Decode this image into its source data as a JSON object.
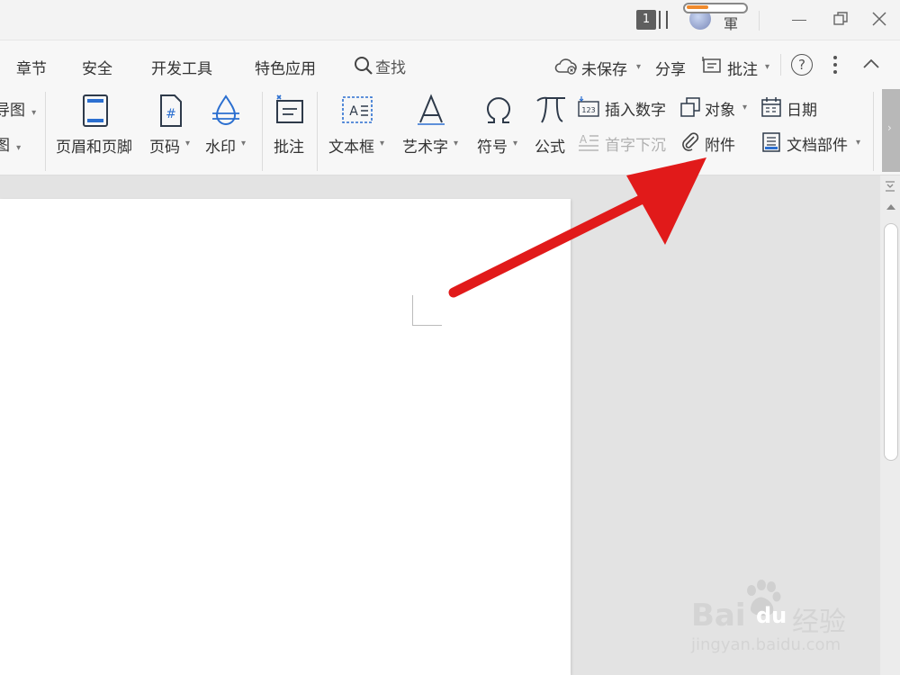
{
  "titlebar": {
    "window_count": "1",
    "user_glyph": "軍",
    "minimize_icon": "minimize-icon",
    "restore_icon": "restore-icon",
    "close_icon": "close-icon"
  },
  "menu": {
    "tabs": [
      {
        "label": "章节"
      },
      {
        "label": "安全"
      },
      {
        "label": "开发工具"
      },
      {
        "label": "特色应用"
      }
    ],
    "search_label": "查找",
    "right": {
      "unsaved_label": "未保存",
      "share_label": "分享",
      "comment_label": "批注"
    }
  },
  "ribbon": {
    "partial_top": "导图",
    "partial_bottom": "图",
    "header_footer": "页眉和页脚",
    "page_number": "页码",
    "watermark": "水印",
    "comment": "批注",
    "textbox": "文本框",
    "wordart": "艺术字",
    "symbol": "符号",
    "formula": "公式",
    "insert_number": "插入数字",
    "drop_cap": "首字下沉",
    "object": "对象",
    "attachment": "附件",
    "date": "日期",
    "doc_parts": "文档部件"
  },
  "watermark": {
    "brand": "Bai",
    "brand2": "du",
    "brand_cn": "经验",
    "url": "jingyan.baidu.com"
  },
  "colors": {
    "arrow": "#e11a1a",
    "accent_blue": "#2b6fd0",
    "icon_dark": "#2e3a4a"
  }
}
